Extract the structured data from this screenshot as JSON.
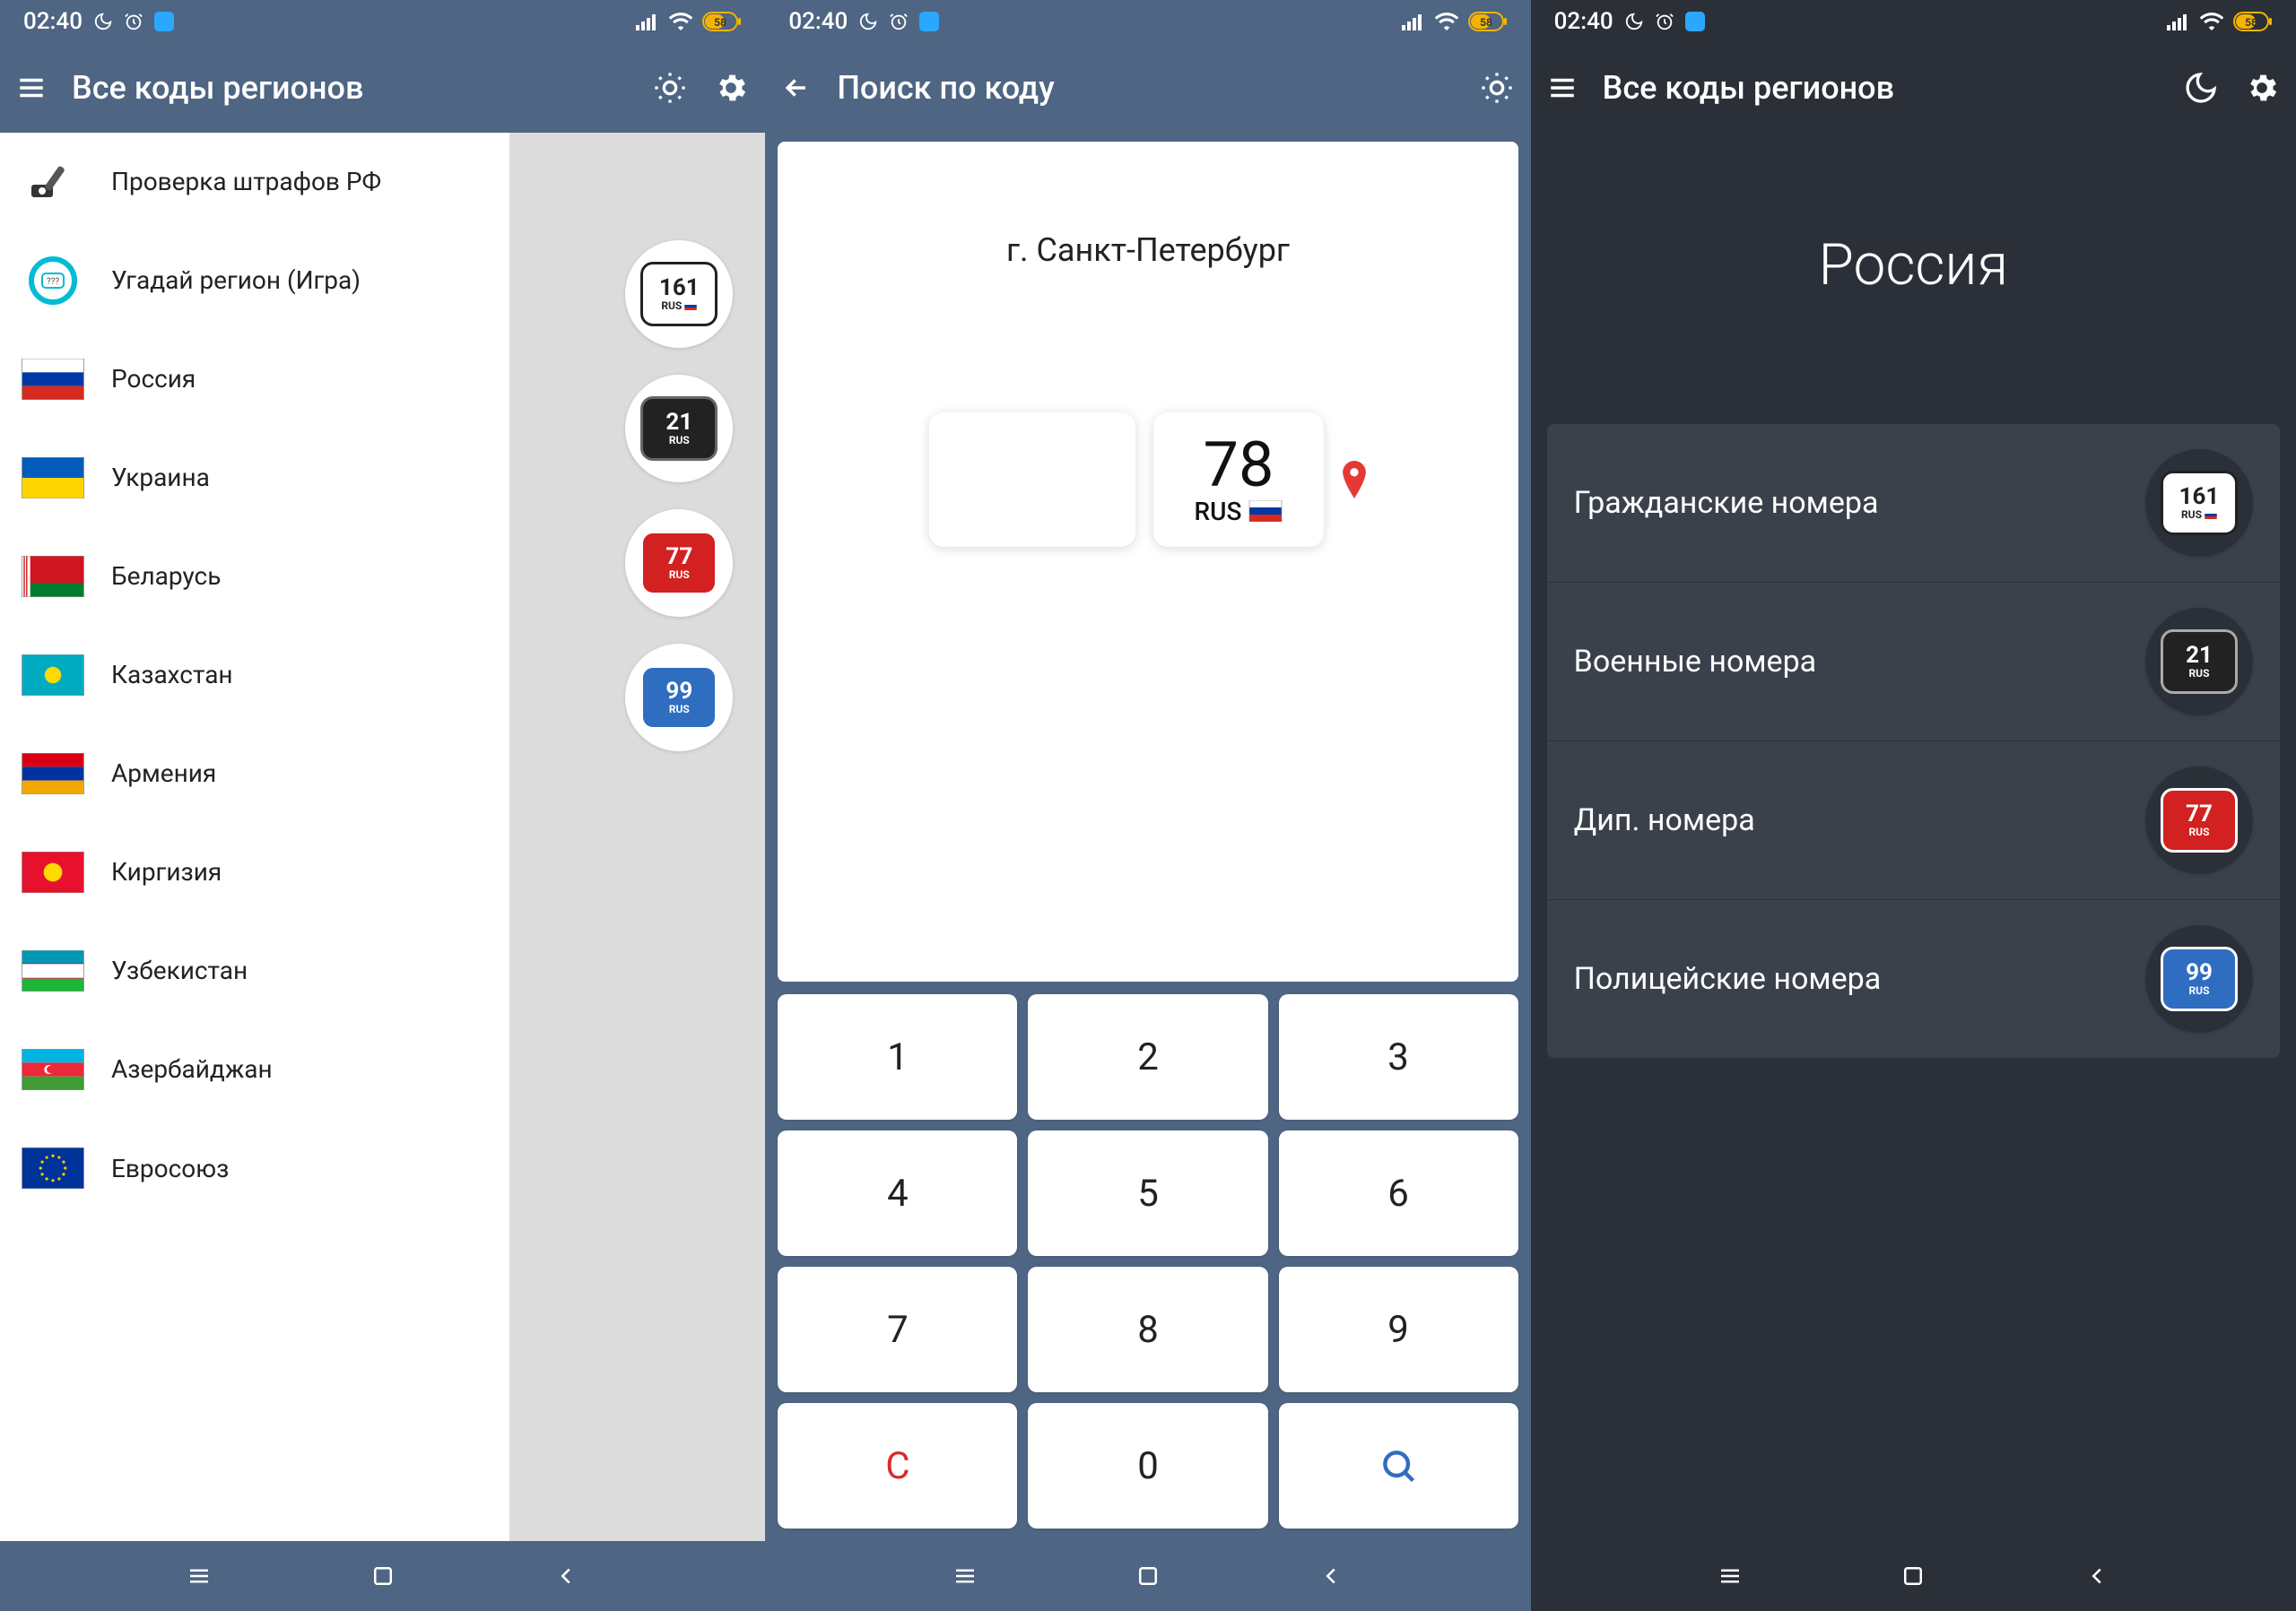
{
  "status": {
    "time": "02:40",
    "battery_text": "58"
  },
  "panel1": {
    "toolbar_title": "Все коды регионов",
    "drawer": [
      {
        "label": "Проверка штрафов РФ",
        "icon": "camera-pen"
      },
      {
        "label": "Угадай регион (Игра)",
        "icon": "quiz"
      },
      {
        "label": "Россия",
        "flag": "ru"
      },
      {
        "label": "Украина",
        "flag": "ua"
      },
      {
        "label": "Беларусь",
        "flag": "by"
      },
      {
        "label": "Казахстан",
        "flag": "kz"
      },
      {
        "label": "Армения",
        "flag": "am"
      },
      {
        "label": "Киргизия",
        "flag": "kg"
      },
      {
        "label": "Узбекистан",
        "flag": "uz"
      },
      {
        "label": "Азербайджан",
        "flag": "az"
      },
      {
        "label": "Евросоюз",
        "flag": "eu"
      }
    ],
    "badges": [
      {
        "num": "161",
        "sub": "RUS",
        "bg": "#ffffff",
        "plate_bg": "#ffffff",
        "plate_border": "#222",
        "text": "#222",
        "flag": true
      },
      {
        "num": "21",
        "sub": "RUS",
        "bg": "#ffffff",
        "plate_bg": "#222222",
        "plate_border": "#666",
        "text": "#fff"
      },
      {
        "num": "77",
        "sub": "RUS",
        "bg": "#ffffff",
        "plate_bg": "#d32020",
        "plate_border": "#fff",
        "text": "#fff"
      },
      {
        "num": "99",
        "sub": "RUS",
        "bg": "#ffffff",
        "plate_bg": "#2f6dc0",
        "plate_border": "#fff",
        "text": "#fff"
      }
    ]
  },
  "panel2": {
    "toolbar_title": "Поиск по коду",
    "region_name": "г. Санкт-Петербург",
    "code": "78",
    "sub": "RUS",
    "keypad": [
      "1",
      "2",
      "3",
      "4",
      "5",
      "6",
      "7",
      "8",
      "9",
      "C",
      "0",
      "search"
    ]
  },
  "panel3": {
    "toolbar_title": "Все коды регионов",
    "header": "Россия",
    "items": [
      {
        "label": "Гражданские номера",
        "badge": {
          "num": "161",
          "sub": "RUS",
          "plate_bg": "#ffffff",
          "plate_border": "#222",
          "text": "#222",
          "flag": true
        }
      },
      {
        "label": "Военные номера",
        "badge": {
          "num": "21",
          "sub": "RUS",
          "plate_bg": "#222222",
          "plate_border": "#aaa",
          "text": "#fff"
        }
      },
      {
        "label": "Дип. номера",
        "badge": {
          "num": "77",
          "sub": "RUS",
          "plate_bg": "#d32020",
          "plate_border": "#fff",
          "text": "#fff"
        }
      },
      {
        "label": "Полицейские номера",
        "badge": {
          "num": "99",
          "sub": "RUS",
          "plate_bg": "#2f6dc0",
          "plate_border": "#fff",
          "text": "#fff"
        }
      }
    ]
  }
}
